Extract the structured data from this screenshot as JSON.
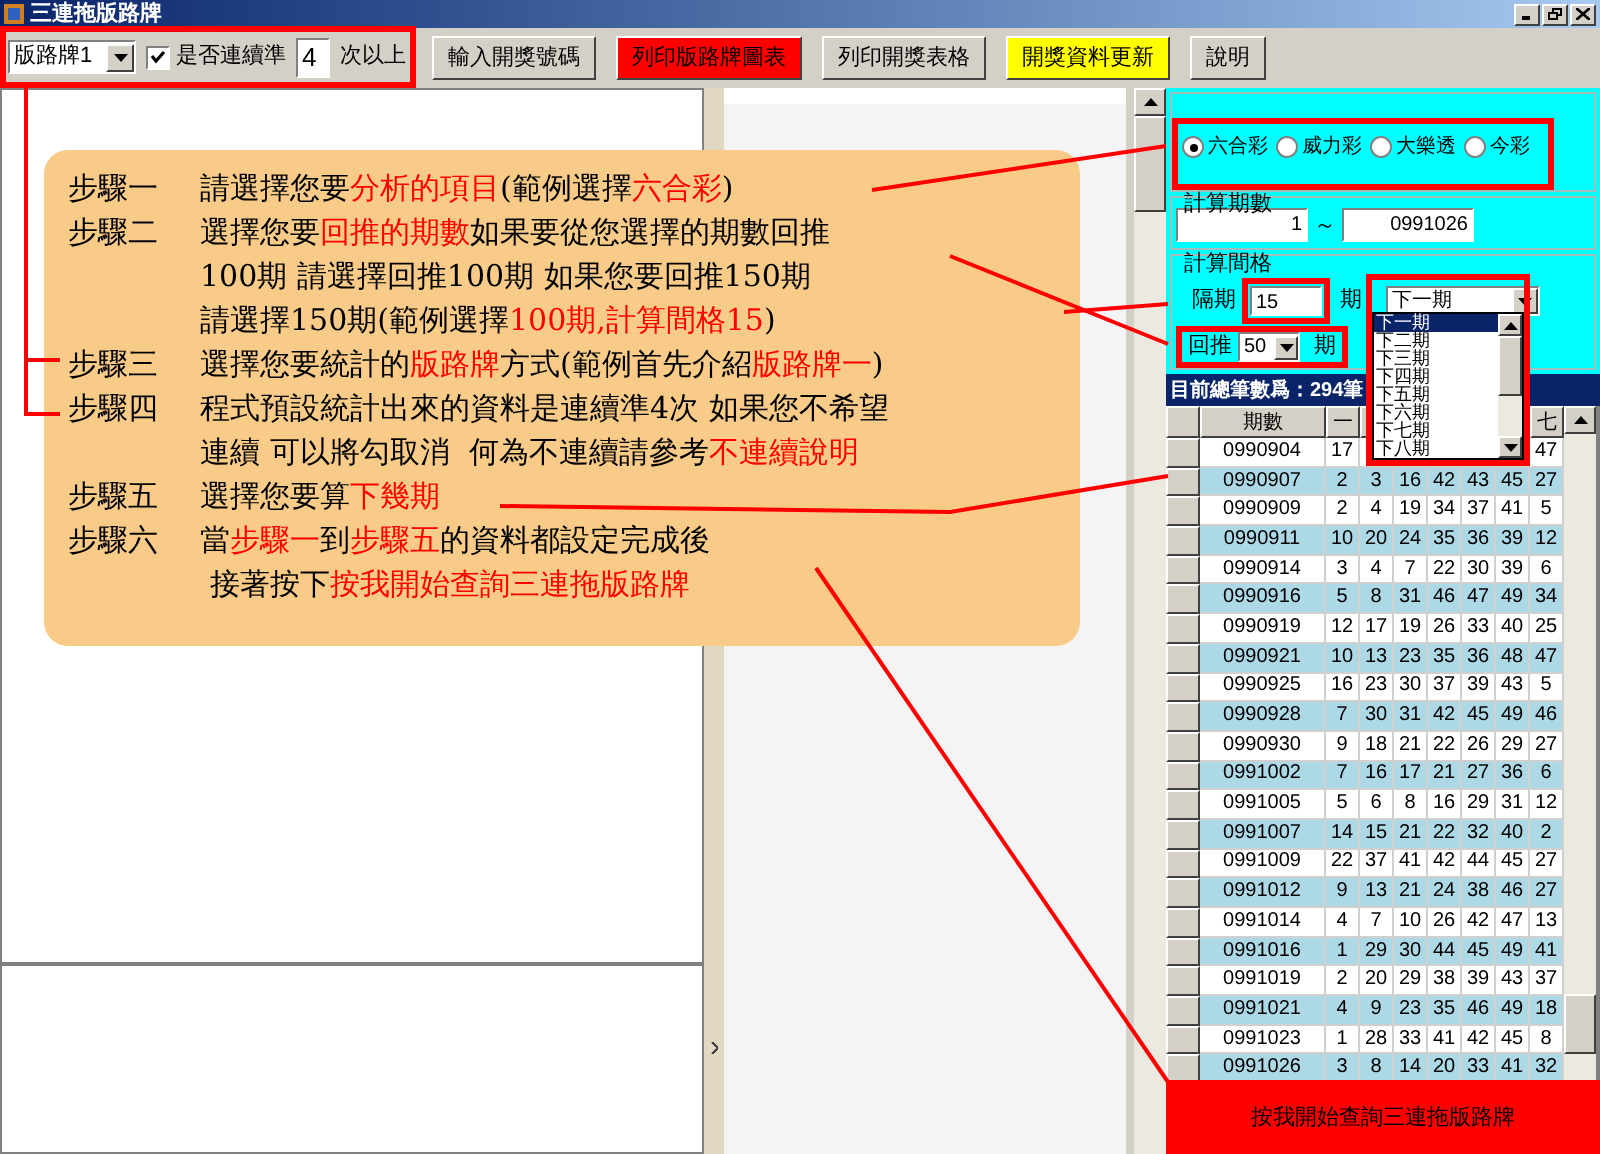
{
  "window": {
    "title": "三連拖版路牌"
  },
  "toolbar": {
    "mode_select": "版路牌1",
    "consecutive": {
      "label": "是否連續準",
      "checked": true
    },
    "count": "4",
    "count_suffix": "次以上",
    "buttons": [
      {
        "label": "輸入開獎號碼",
        "color": "#d4d0c8"
      },
      {
        "label": "列印版路牌圖表",
        "color": "#ff0000"
      },
      {
        "label": "列印開獎表格",
        "color": "#d4d0c8"
      },
      {
        "label": "開獎資料更新",
        "color": "#ffff00"
      },
      {
        "label": "說明",
        "color": "#d4d0c8"
      }
    ]
  },
  "instructions": [
    {
      "step": "步驟一",
      "lines": [
        [
          {
            "text": "請選擇您要",
            "highlight": false
          },
          {
            "text": "分析的項目",
            "highlight": true
          },
          {
            "text": "(範例選擇",
            "highlight": false
          },
          {
            "text": "六合彩",
            "highlight": true
          },
          {
            "text": ")",
            "highlight": false
          }
        ]
      ]
    },
    {
      "step": "步驟二",
      "lines": [
        [
          {
            "text": "選擇您要",
            "highlight": false
          },
          {
            "text": "回推的期數",
            "highlight": true
          },
          {
            "text": "如果要從您選擇的期數回推",
            "highlight": false
          }
        ],
        [
          {
            "text": "100期 請選擇回推100期 如果您要回推150期",
            "highlight": false
          }
        ],
        [
          {
            "text": "請選擇150期(範例選擇",
            "highlight": false
          },
          {
            "text": "100期,計算間格15",
            "highlight": true
          },
          {
            "text": ")",
            "highlight": false
          }
        ]
      ]
    },
    {
      "step": "步驟三",
      "lines": [
        [
          {
            "text": "選擇您要統計的",
            "highlight": false
          },
          {
            "text": "版路牌",
            "highlight": true
          },
          {
            "text": "方式(範例首先介紹",
            "highlight": false
          },
          {
            "text": "版路牌一",
            "highlight": true
          },
          {
            "text": ")",
            "highlight": false
          }
        ]
      ]
    },
    {
      "step": "步驟四",
      "lines": [
        [
          {
            "text": "程式預設統計出來的資料是連續準4次 如果您不希望",
            "highlight": false
          }
        ],
        [
          {
            "text": "連續 可以將勾取消  何為不連續請參考",
            "highlight": false
          },
          {
            "text": "不連續說明",
            "highlight": true
          }
        ]
      ]
    },
    {
      "step": "步驟五",
      "lines": [
        [
          {
            "text": "選擇您要算",
            "highlight": false
          },
          {
            "text": "下幾期",
            "highlight": true
          }
        ]
      ]
    },
    {
      "step": "步驟六",
      "lines": [
        [
          {
            "text": "當",
            "highlight": false
          },
          {
            "text": "步驟一",
            "highlight": true
          },
          {
            "text": "到",
            "highlight": false
          },
          {
            "text": "步驟五",
            "highlight": true
          },
          {
            "text": "的資料都設定完成後",
            "highlight": false
          }
        ],
        [
          {
            "text": " 接著按下",
            "highlight": false
          },
          {
            "text": "按我開始查詢三連拖版路牌",
            "highlight": true
          }
        ]
      ]
    }
  ],
  "games": [
    {
      "label": "六合彩",
      "selected": true
    },
    {
      "label": "威力彩",
      "selected": false
    },
    {
      "label": "大樂透",
      "selected": false
    },
    {
      "label": "今彩",
      "selected": false
    }
  ],
  "period_range": {
    "title": "計算期數",
    "from": "1",
    "separator": "～",
    "to": "0991026"
  },
  "interval": {
    "title": "計算間格",
    "label": "隔期",
    "value": "15",
    "unit": "期",
    "target": "下一期",
    "back_label": "回推",
    "back_value": "50",
    "back_unit": "期",
    "options": [
      {
        "label": "下一期",
        "selected": true
      },
      {
        "label": "下二期",
        "selected": false
      },
      {
        "label": "下三期",
        "selected": false
      },
      {
        "label": "下四期",
        "selected": false
      },
      {
        "label": "下五期",
        "selected": false
      },
      {
        "label": "下六期",
        "selected": false
      },
      {
        "label": "下七期",
        "selected": false
      },
      {
        "label": "下八期",
        "selected": false
      }
    ]
  },
  "table": {
    "caption": "目前總筆數爲：294筆",
    "columns": [
      "期數",
      "一",
      null,
      null,
      null,
      null,
      null,
      "七"
    ],
    "rows": [
      [
        "0990904",
        "17",
        null,
        null,
        null,
        null,
        null,
        "47"
      ],
      [
        "0990907",
        "2",
        "3",
        "16",
        "42",
        "43",
        "45",
        "27"
      ],
      [
        "0990909",
        "2",
        "4",
        "19",
        "34",
        "37",
        "41",
        "5"
      ],
      [
        "0990911",
        "10",
        "20",
        "24",
        "35",
        "36",
        "39",
        "12"
      ],
      [
        "0990914",
        "3",
        "4",
        "7",
        "22",
        "30",
        "39",
        "6"
      ],
      [
        "0990916",
        "5",
        "8",
        "31",
        "46",
        "47",
        "49",
        "34"
      ],
      [
        "0990919",
        "12",
        "17",
        "19",
        "26",
        "33",
        "40",
        "25"
      ],
      [
        "0990921",
        "10",
        "13",
        "23",
        "35",
        "36",
        "48",
        "47"
      ],
      [
        "0990925",
        "16",
        "23",
        "30",
        "37",
        "39",
        "43",
        "5"
      ],
      [
        "0990928",
        "7",
        "30",
        "31",
        "42",
        "45",
        "49",
        "46"
      ],
      [
        "0990930",
        "9",
        "18",
        "21",
        "22",
        "26",
        "29",
        "27"
      ],
      [
        "0991002",
        "7",
        "16",
        "17",
        "21",
        "27",
        "36",
        "6"
      ],
      [
        "0991005",
        "5",
        "6",
        "8",
        "16",
        "29",
        "31",
        "12"
      ],
      [
        "0991007",
        "14",
        "15",
        "21",
        "22",
        "32",
        "40",
        "2"
      ],
      [
        "0991009",
        "22",
        "37",
        "41",
        "42",
        "44",
        "45",
        "27"
      ],
      [
        "0991012",
        "9",
        "13",
        "21",
        "24",
        "38",
        "46",
        "27"
      ],
      [
        "0991014",
        "4",
        "7",
        "10",
        "26",
        "42",
        "47",
        "13"
      ],
      [
        "0991016",
        "1",
        "29",
        "30",
        "44",
        "45",
        "49",
        "41"
      ],
      [
        "0991019",
        "2",
        "20",
        "29",
        "38",
        "39",
        "43",
        "37"
      ],
      [
        "0991021",
        "4",
        "9",
        "23",
        "35",
        "46",
        "49",
        "18"
      ],
      [
        "0991023",
        "1",
        "28",
        "33",
        "41",
        "42",
        "45",
        "8"
      ],
      [
        "0991026",
        "3",
        "8",
        "14",
        "20",
        "33",
        "41",
        "32"
      ]
    ]
  },
  "start_button": "按我開始查詢三連拖版路牌"
}
